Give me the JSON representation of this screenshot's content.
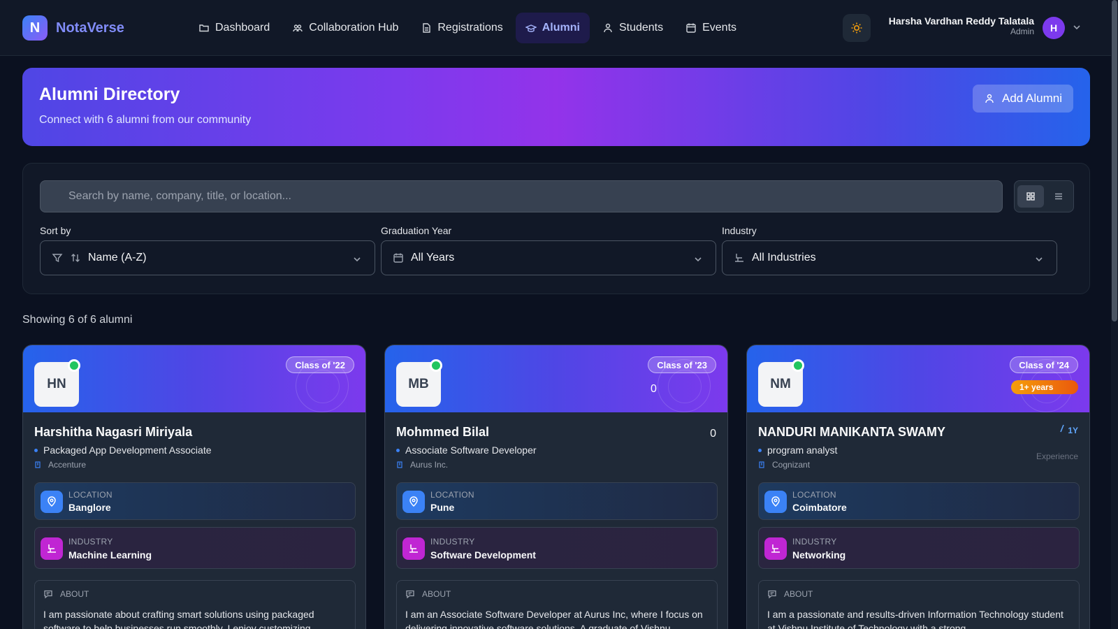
{
  "app": {
    "logo_letter": "N",
    "name": "NotaVerse"
  },
  "nav": [
    {
      "label": "Dashboard",
      "icon": "folder-icon"
    },
    {
      "label": "Collaboration Hub",
      "icon": "users-icon"
    },
    {
      "label": "Registrations",
      "icon": "document-icon"
    },
    {
      "label": "Alumni",
      "icon": "graduation-icon",
      "active": true
    },
    {
      "label": "Students",
      "icon": "user-icon"
    },
    {
      "label": "Events",
      "icon": "calendar-icon"
    }
  ],
  "user": {
    "name": "Harsha Vardhan Reddy Talatala",
    "role": "Admin",
    "initial": "H"
  },
  "hero": {
    "title": "Alumni Directory",
    "subtitle": "Connect with 6 alumni from our community",
    "add_label": "Add Alumni"
  },
  "search": {
    "placeholder": "Search by name, company, title, or location..."
  },
  "filters": {
    "sort": {
      "label": "Sort by",
      "value": "Name (A-Z)"
    },
    "year": {
      "label": "Graduation Year",
      "value": "All Years"
    },
    "industry": {
      "label": "Industry",
      "value": "All Industries"
    }
  },
  "showing": "Showing 6 of 6 alumni",
  "labels": {
    "location": "LOCATION",
    "industry": "INDUSTRY",
    "about": "ABOUT"
  },
  "cards": [
    {
      "initials": "HN",
      "class": "Class of '22",
      "name": "Harshitha Nagasri Miriyala",
      "role": "Packaged App Development Associate",
      "company": "Accenture",
      "location": "Banglore",
      "industry": "Machine Learning",
      "about": "I am passionate about crafting smart solutions using packaged software to help businesses run smoothly. I enjoy customizing"
    },
    {
      "initials": "MB",
      "class": "Class of '23",
      "top_zero": "0",
      "right_zero": "0",
      "name": "Mohmmed Bilal",
      "role": "Associate Software Developer",
      "company": "Aurus Inc.",
      "location": "Pune",
      "industry": "Software Development",
      "about": "I am an Associate Software Developer at Aurus Inc, where I focus on delivering innovative software solutions. A graduate of Vishnu"
    },
    {
      "initials": "NM",
      "class": "Class of '24",
      "exp_badge": "1+ years",
      "exp_value": "1Y",
      "exp_label": "Experience",
      "name": "NANDURI MANIKANTA SWAMY",
      "role": "program analyst",
      "company": "Cognizant",
      "location": "Coimbatore",
      "industry": "Networking",
      "about": "I am a passionate and results-driven Information Technology student at Vishnu Institute of Technology with a strong"
    }
  ]
}
